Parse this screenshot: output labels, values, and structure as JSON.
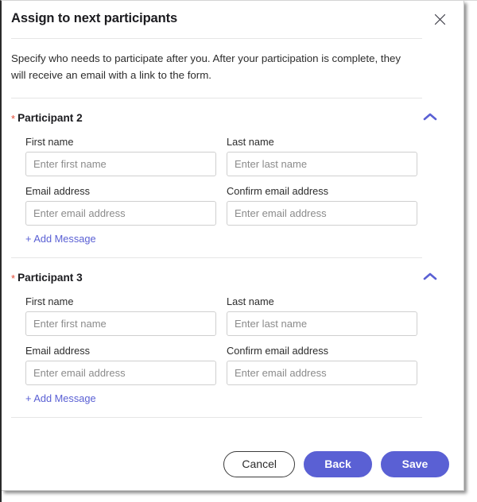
{
  "dialog": {
    "title": "Assign to next participants",
    "close_icon": "close-icon",
    "intro": "Specify who needs to participate after you. After your participation is complete, they will receive an email with a link to the form."
  },
  "colors": {
    "accent": "#5a60d4",
    "required_star": "#e34935",
    "text": "#1b1b1f",
    "border": "#cfcfcf",
    "rule": "#e6e6e6"
  },
  "sections": [
    {
      "required_marker": "*",
      "title": "Participant 2",
      "collapse_icon": "chevron-up-icon",
      "rows": [
        {
          "fields": [
            {
              "label": "First name",
              "value": "",
              "placeholder": "Enter first name"
            },
            {
              "label": "Last name",
              "value": "",
              "placeholder": "Enter last name"
            }
          ]
        },
        {
          "fields": [
            {
              "label": "Email address",
              "value": "",
              "placeholder": "Enter email address"
            },
            {
              "label": "Confirm email address",
              "value": "",
              "placeholder": "Enter email address"
            }
          ]
        }
      ],
      "add_message_label": "+ Add Message"
    },
    {
      "required_marker": "*",
      "title": "Participant 3",
      "collapse_icon": "chevron-up-icon",
      "rows": [
        {
          "fields": [
            {
              "label": "First name",
              "value": "",
              "placeholder": "Enter first name"
            },
            {
              "label": "Last name",
              "value": "",
              "placeholder": "Enter last name"
            }
          ]
        },
        {
          "fields": [
            {
              "label": "Email address",
              "value": "",
              "placeholder": "Enter email address"
            },
            {
              "label": "Confirm email address",
              "value": "",
              "placeholder": "Enter email address"
            }
          ]
        }
      ],
      "add_message_label": "+ Add Message"
    }
  ],
  "footer": {
    "cancel_label": "Cancel",
    "back_label": "Back",
    "save_label": "Save"
  }
}
